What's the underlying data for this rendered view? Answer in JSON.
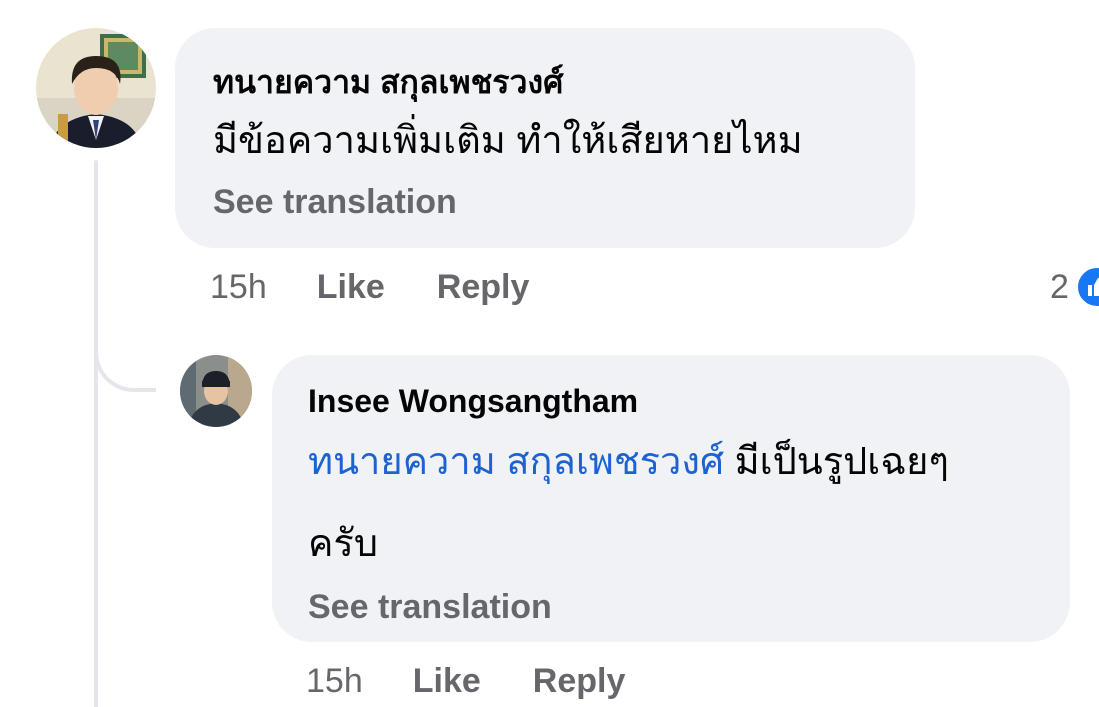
{
  "comment": {
    "author": "ทนายความ สกุลเพชรวงศ์",
    "text": "มีข้อความเพิ่มเติม ทำให้เสียหายไหม",
    "see_translation": "See translation",
    "time": "15h",
    "like_label": "Like",
    "reply_label": "Reply",
    "reaction_count": "2",
    "reaction_icon": "like-thumb-icon"
  },
  "reply": {
    "author": "Insee Wongsangtham",
    "mention": "ทนายความ สกุลเพชรวงศ์",
    "text": " มีเป็นรูปเฉยๆ ครับ",
    "see_translation": "See translation",
    "time": "15h",
    "like_label": "Like",
    "reply_label": "Reply"
  },
  "colors": {
    "bubble": "#f0f2f5",
    "mention": "#1c63d0",
    "meta": "#65676b",
    "reaction": "#1877f2"
  }
}
